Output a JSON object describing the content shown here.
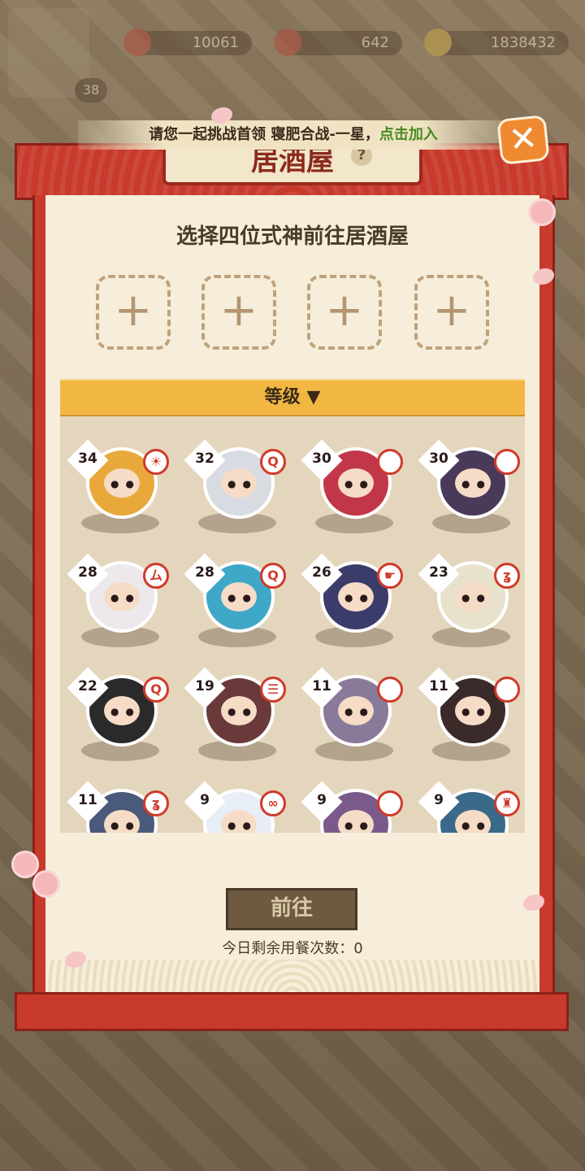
{
  "topbar": {
    "player_level": "38",
    "resources": [
      {
        "icon": "stamina-icon",
        "value": "10061"
      },
      {
        "icon": "jade-icon",
        "value": "642"
      },
      {
        "icon": "coin-icon",
        "value": "1838432"
      }
    ]
  },
  "banner": {
    "text": "请您一起挑战首领 寝肥合战-一星，",
    "join": "点击加入"
  },
  "dialog": {
    "title": "居酒屋",
    "help": "?",
    "subtitle": "选择四位式神前往居酒屋",
    "slots": [
      "+",
      "+",
      "+",
      "+"
    ],
    "sort_label": "等级",
    "go_button": "前往",
    "remaining": "今日剩余用餐次数：0"
  },
  "shikigami": [
    {
      "level": "34",
      "color": "#e9a83a",
      "skill": "☀"
    },
    {
      "level": "32",
      "color": "#d9dbe3",
      "skill": "Q"
    },
    {
      "level": "30",
      "color": "#c2364a",
      "skill": ""
    },
    {
      "level": "30",
      "color": "#4a3a5a",
      "skill": ""
    },
    {
      "level": "28",
      "color": "#ece8ec",
      "skill": "ム"
    },
    {
      "level": "28",
      "color": "#3fa8c8",
      "skill": "Q"
    },
    {
      "level": "26",
      "color": "#3c3c6a",
      "skill": "☛"
    },
    {
      "level": "23",
      "color": "#e8e2cc",
      "skill": "ʓ"
    },
    {
      "level": "22",
      "color": "#2a2a2a",
      "skill": "Q"
    },
    {
      "level": "19",
      "color": "#6a3a3a",
      "skill": "☰"
    },
    {
      "level": "11",
      "color": "#8a7a9a",
      "skill": ""
    },
    {
      "level": "11",
      "color": "#3a2a2a",
      "skill": ""
    },
    {
      "level": "11",
      "color": "#4a5a7a",
      "skill": "ʓ"
    },
    {
      "level": "9",
      "color": "#e8eef6",
      "skill": "∞"
    },
    {
      "level": "9",
      "color": "#7a5a8a",
      "skill": ""
    },
    {
      "level": "9",
      "color": "#3a6a8a",
      "skill": "♜"
    }
  ]
}
